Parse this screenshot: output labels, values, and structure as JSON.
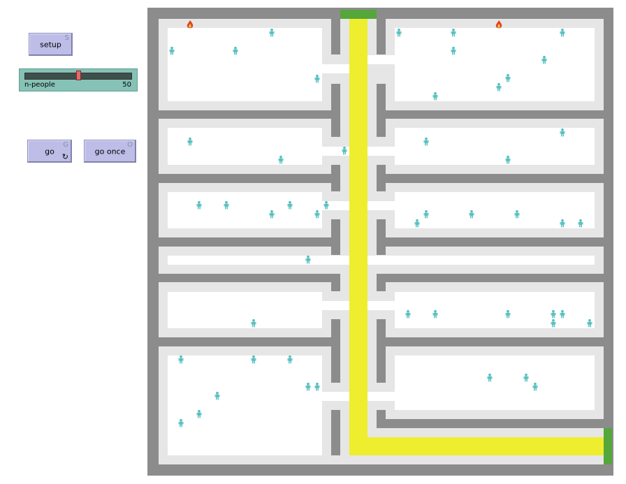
{
  "interface": {
    "setup_button": {
      "label": "setup",
      "key": "S"
    },
    "go_button": {
      "label": "go",
      "key": "G",
      "forever_icon": "↻"
    },
    "go_once_button": {
      "label": "go once",
      "key": "O"
    },
    "slider": {
      "name": "n-people",
      "value": "50",
      "fraction": 0.5
    }
  },
  "world": {
    "colors": {
      "background": "#ffffff",
      "wall_outer": "#8c8c8c",
      "wall_inner": "#e6e6e6",
      "path": "#eeee2e",
      "exit": "#55a63b",
      "person": "#58c0c0",
      "fire": "#dd4422"
    },
    "icons": {
      "person": "person-icon",
      "fire": "fire-icon"
    }
  }
}
